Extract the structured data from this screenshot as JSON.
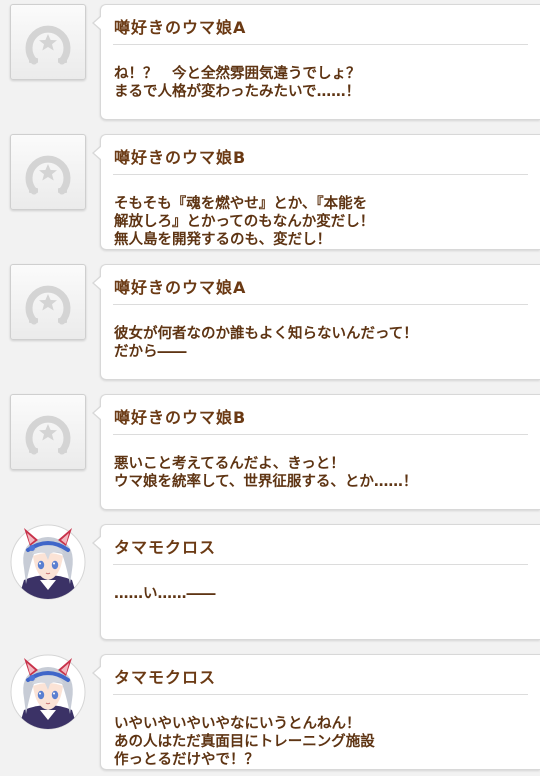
{
  "icons": {
    "placeholder": "horseshoe-emblem-icon",
    "character": "tamamo-cross-portrait-icon"
  },
  "colors": {
    "speaker_text": "#6b3a14",
    "dialogue_text": "#5e3413",
    "background": "#f2f2f2"
  },
  "entries": [
    {
      "speaker": "噂好きのウマ娘A",
      "text": "ね！？　今と全然雰囲気違うでしょ？\nまるで人格が変わったみたいで……！"
    },
    {
      "speaker": "噂好きのウマ娘B",
      "text": "そもそも『魂を燃やせ』とか、『本能を\n解放しろ』とかってのもなんか変だし！\n無人島を開発するのも、変だし！"
    },
    {
      "speaker": "噂好きのウマ娘A",
      "text": "彼女が何者なのか誰もよく知らないんだって！\nだから――"
    },
    {
      "speaker": "噂好きのウマ娘B",
      "text": "悪いこと考えてるんだよ、きっと！\nウマ娘を統率して、世界征服する、とか……！"
    },
    {
      "speaker": "タマモクロス",
      "text": "……い……――"
    },
    {
      "speaker": "タマモクロス",
      "text": "いやいやいやいやなにいうとんねん！\nあの人はただ真面目にトレーニング施設\n作っとるだけやで！？"
    }
  ]
}
